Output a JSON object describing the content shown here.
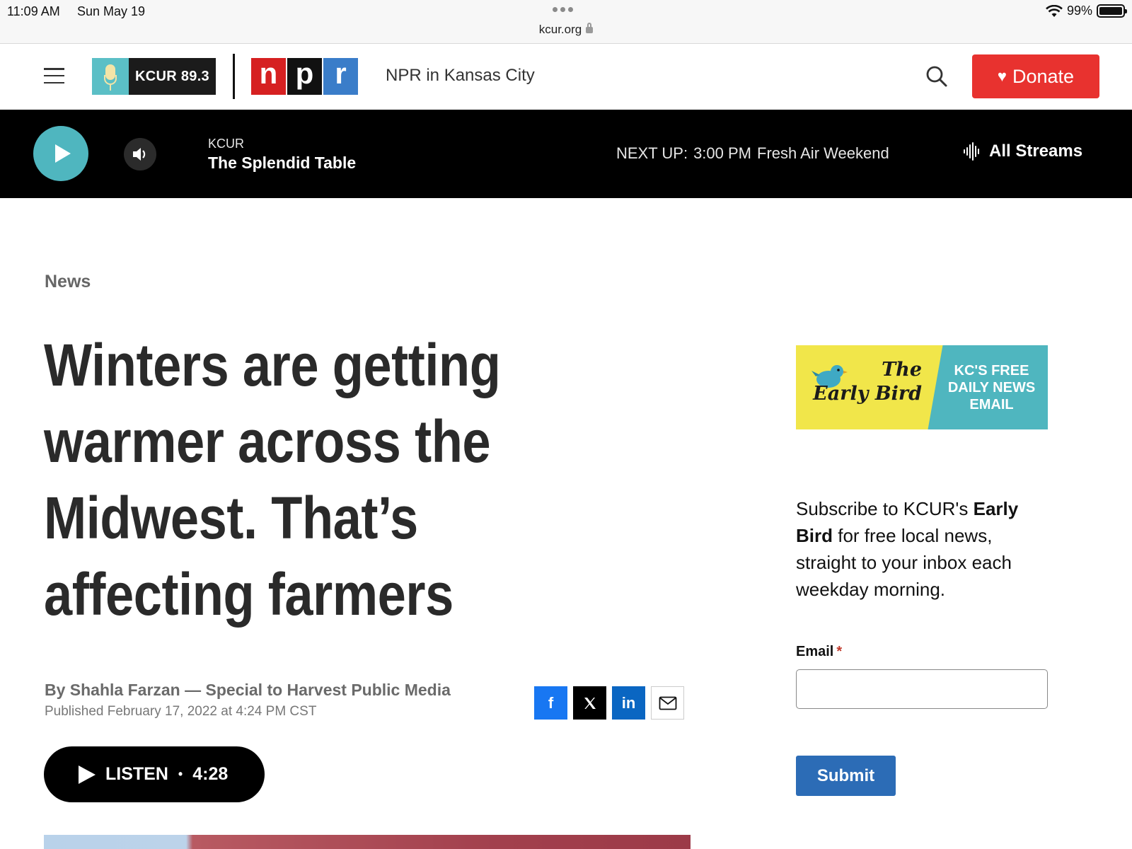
{
  "status_bar": {
    "time": "11:09 AM",
    "date": "Sun May 19",
    "url": "kcur.org",
    "battery": "99%",
    "battery_level": 0.99
  },
  "header": {
    "station_logo": "KCUR 89.3",
    "npr_letters": [
      "n",
      "p",
      "r"
    ],
    "tagline": "NPR in Kansas City",
    "donate_label": "Donate",
    "icons": [
      "menu-icon",
      "search-icon",
      "heart-icon"
    ]
  },
  "player": {
    "station": "KCUR",
    "show": "The Splendid Table",
    "next_up_label": "NEXT UP:",
    "next_up_time": "3:00 PM",
    "next_up_show": "Fresh Air Weekend",
    "all_streams_label": "All Streams",
    "icons": [
      "play-icon",
      "volume-icon",
      "audio-wave-icon"
    ]
  },
  "article": {
    "category": "News",
    "headline": "Winters are getting warmer across the Midwest. That’s affecting farmers",
    "byline_prefix": "By",
    "author": "Shahla Farzan",
    "affiliation": "— Special to Harvest Public Media",
    "published": "Published February 17, 2022 at 4:24 PM CST",
    "share_icons": [
      "facebook-icon",
      "x-icon",
      "linkedin-icon",
      "email-icon"
    ],
    "share_fb": "f",
    "share_in": "in",
    "listen_label": "LISTEN",
    "listen_sep": "•",
    "listen_duration": "4:28"
  },
  "sidebar": {
    "promo_title_line1": "The",
    "promo_title_line2": "Early Bird",
    "promo_tagline_line1": "KC'S FREE",
    "promo_tagline_line2": "DAILY NEWS",
    "promo_tagline_line3": "EMAIL",
    "subscribe_pre": "Subscribe to KCUR's ",
    "subscribe_bold": "Early Bird",
    "subscribe_post": " for free local news, straight to your inbox each weekday morning.",
    "email_label": "Email",
    "email_required": "*",
    "email_value": "",
    "submit_label": "Submit"
  },
  "colors": {
    "donate": "#e8322f",
    "player_bg": "#000000",
    "play_button": "#4fb6bf",
    "npr_red": "#d62021",
    "npr_blue": "#3a7dc9",
    "promo_yellow": "#f1e64a",
    "promo_teal": "#4fb6bf",
    "submit": "#2c6cb6"
  }
}
